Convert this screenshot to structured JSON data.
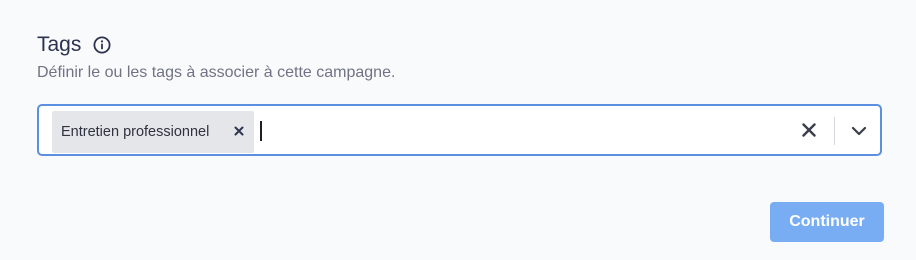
{
  "section": {
    "title": "Tags",
    "info_icon": "info-circle-icon",
    "description": "Définir le ou les tags à associer à cette campagne."
  },
  "tags_select": {
    "selected_tags": [
      {
        "label": "Entretien professionnel",
        "remove_icon": "close-icon"
      }
    ],
    "input_value": "",
    "clear_icon": "close-icon",
    "dropdown_icon": "chevron-down-icon",
    "border_color": "#5d8fe0"
  },
  "footer": {
    "continue_label": "Continuer",
    "continue_color": "#78adf3"
  }
}
